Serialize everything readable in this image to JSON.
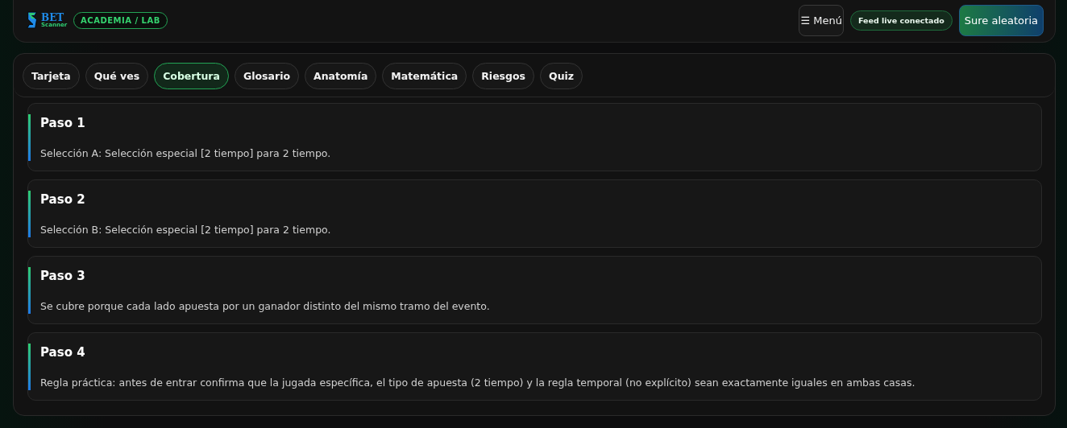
{
  "header": {
    "logo": {
      "top": "BET",
      "bottom": "Scanner"
    },
    "badge": "ACADEMIA / LAB",
    "menu_button": {
      "icon": "☰",
      "label": "Menú"
    },
    "status": "Feed live conectado",
    "action_button": "Sure aleatoria"
  },
  "tabs": [
    {
      "label": "Tarjeta",
      "selected": false
    },
    {
      "label": "Qué ves",
      "selected": false
    },
    {
      "label": "Cobertura",
      "selected": true
    },
    {
      "label": "Glosario",
      "selected": false
    },
    {
      "label": "Anatomía",
      "selected": false
    },
    {
      "label": "Matemática",
      "selected": false
    },
    {
      "label": "Riesgos",
      "selected": false
    },
    {
      "label": "Quiz",
      "selected": false
    }
  ],
  "steps": [
    {
      "title": "Paso 1",
      "text": "Selección A: Selección especial [2 tiempo] para 2 tiempo."
    },
    {
      "title": "Paso 2",
      "text": "Selección B: Selección especial [2 tiempo] para 2 tiempo."
    },
    {
      "title": "Paso 3",
      "text": "Se cubre porque cada lado apuesta por un ganador distinto del mismo tramo del evento."
    },
    {
      "title": "Paso 4",
      "text": "Regla práctica: antes de entrar confirma que la jugada específica, el tipo de apuesta (2 tiempo) y la regla temporal (no explícito) sean exactamente iguales en ambas casas."
    }
  ]
}
